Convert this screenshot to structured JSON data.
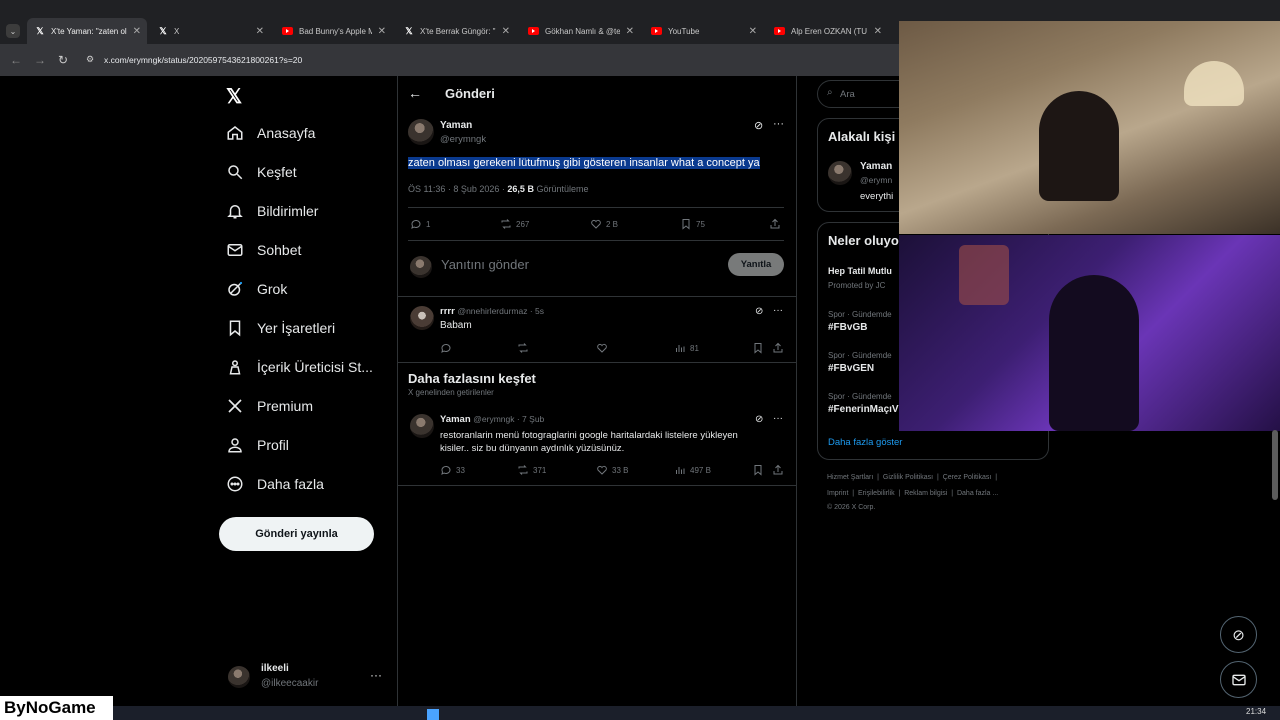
{
  "browser": {
    "tabs": [
      {
        "title": "X'te Yaman: \"zaten ol",
        "icon": "x-icon",
        "active": true
      },
      {
        "title": "X",
        "icon": "x-icon",
        "active": false
      },
      {
        "title": "Bad Bunny's Apple M",
        "icon": "youtube-icon",
        "active": false
      },
      {
        "title": "X'te Berrak Güngör: \"",
        "icon": "x-icon",
        "active": false
      },
      {
        "title": "Gökhan Namlı & @te",
        "icon": "youtube-icon",
        "active": false
      },
      {
        "title": "YouTube",
        "icon": "youtube-icon",
        "active": false
      },
      {
        "title": "Alp Eren OZKAN (TU",
        "icon": "youtube-icon",
        "active": false
      }
    ],
    "url": "x.com/erymngk/status/2020597543621800261?s=20"
  },
  "nav": {
    "items": [
      {
        "label": "Anasayfa",
        "icon": "home-icon"
      },
      {
        "label": "Keşfet",
        "icon": "search-icon"
      },
      {
        "label": "Bildirimler",
        "icon": "bell-icon"
      },
      {
        "label": "Sohbet",
        "icon": "mail-icon"
      },
      {
        "label": "Grok",
        "icon": "grok-icon"
      },
      {
        "label": "Yer İşaretleri",
        "icon": "bookmark-icon"
      },
      {
        "label": "İçerik Üreticisi St...",
        "icon": "creator-icon"
      },
      {
        "label": "Premium",
        "icon": "x-premium-icon"
      },
      {
        "label": "Profil",
        "icon": "person-icon"
      },
      {
        "label": "Daha fazla",
        "icon": "more-circle-icon"
      }
    ],
    "post_button": "Gönderi yayınla",
    "account": {
      "name": "ilkeeli",
      "handle": "@ilkeecaakir"
    }
  },
  "main": {
    "header_title": "Gönderi",
    "post": {
      "author": "Yaman",
      "handle": "@erymngk",
      "text": "zaten olması gerekeni lütufmuş gibi gösteren insanlar what a concept ya",
      "time": "ÖS 11:36 · 8 Şub 2026 ·",
      "views": "26,5 B",
      "views_label": "Görüntüleme",
      "replies": "1",
      "reposts": "267",
      "likes": "2 B",
      "bookmarks": "75"
    },
    "reply_placeholder": "Yanıtını gönder",
    "reply_button": "Yanıtla",
    "reply": {
      "author": "rrrr",
      "handle": "@nnehirlerdurmaz · 5s",
      "text": "Babam",
      "views": "81"
    },
    "discover_title": "Daha fazlasını keşfet",
    "discover_subtitle": "X genelinden getirilenler",
    "discover_post": {
      "author": "Yaman",
      "handle": "@erymngk · 7 Şub",
      "text_line1": "restoranlarin menü fotograglarini google haritalardaki listelere yükleyen",
      "text_line2": "kisiler.. siz bu dünyanın aydınlık yüzüsünüz.",
      "replies": "33",
      "reposts": "371",
      "likes": "33 B",
      "views": "497 B"
    }
  },
  "right": {
    "search_placeholder": "Ara",
    "related_title": "Alakalı kişi",
    "related_name": "Yaman",
    "related_handle": "@erymn",
    "related_bio": "everythi",
    "trends_title": "Neler oluyo",
    "trends": [
      {
        "context": "Hep Tatil Mutlu",
        "sub": "Promoted by JC"
      },
      {
        "context": "Spor · Gündemde",
        "tag": "#FBvGB"
      },
      {
        "context": "Spor · Gündemde",
        "tag": "#FBvGEN"
      },
      {
        "context": "Spor · Gündemde",
        "tag": "#FenerinMaçıV"
      }
    ],
    "show_more": "Daha fazla göster",
    "footer_line1": [
      "Hizmet Şartları",
      "Gizlilik Politikası",
      "Çerez Politikası"
    ],
    "footer_line2": [
      "Imprint",
      "Erişilebilirlik",
      "Reklam bilgisi",
      "Daha fazla ..."
    ],
    "copyright": "© 2026 X Corp."
  },
  "overlay": {
    "logo_text": "ByNoGame",
    "clock": "21:34"
  }
}
